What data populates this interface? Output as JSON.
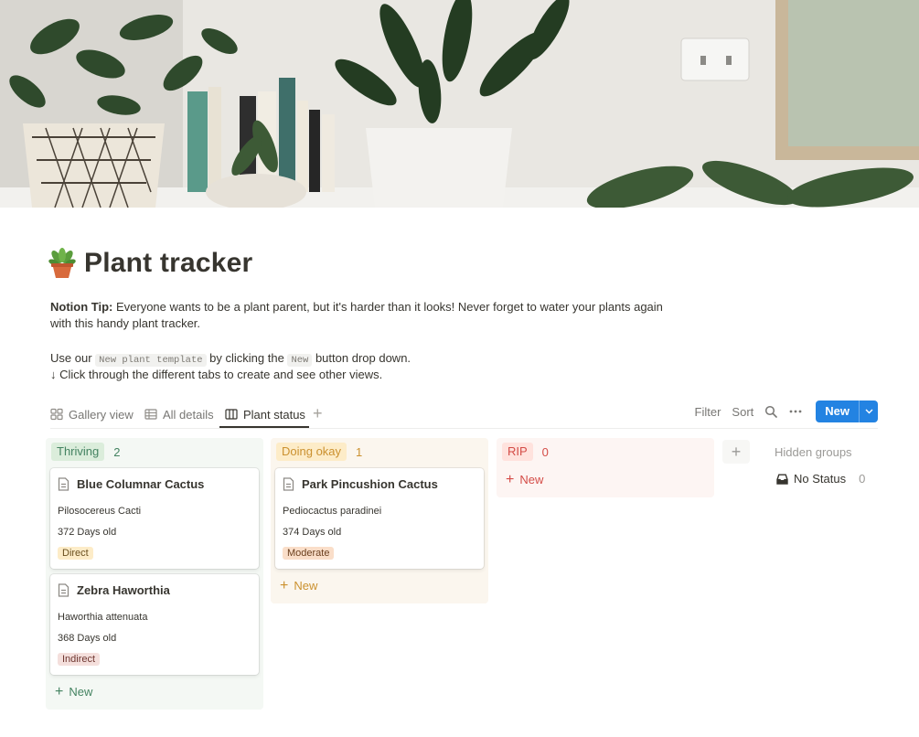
{
  "page": {
    "title": "Plant tracker",
    "tip_label": "Notion Tip:",
    "tip_text": " Everyone wants to be a plant parent, but it's harder than it looks! Never forget to water your plants again with this handy plant tracker.",
    "use_prefix": "Use our ",
    "template_code": "New plant template",
    "use_middle": " by clicking the ",
    "new_code": "New",
    "use_suffix": " button drop down.",
    "click_line": "↓ Click through the different tabs to create and see other views."
  },
  "views": {
    "tabs": [
      {
        "label": "Gallery view",
        "icon": "gallery-icon"
      },
      {
        "label": "All details",
        "icon": "table-icon"
      },
      {
        "label": "Plant status",
        "icon": "board-icon",
        "active": true
      }
    ],
    "filter": "Filter",
    "sort": "Sort",
    "new_button": "New"
  },
  "board": {
    "columns": [
      {
        "name": "Thriving",
        "count": "2",
        "color": "#448361",
        "pill_bg": "#dbeddb",
        "col_bg": "#f4f8f4",
        "cards": [
          {
            "title": "Blue Columnar Cactus",
            "species": "Pilosocereus Cacti",
            "age": "372 Days old",
            "light": "Direct",
            "tag_bg": "#fdecc8",
            "tag_color": "#6a4f1e"
          },
          {
            "title": "Zebra Haworthia",
            "species": "Haworthia attenuata",
            "age": "368 Days old",
            "light": "Indirect",
            "tag_bg": "#f4dfdc",
            "tag_color": "#6e3630"
          }
        ],
        "new_label": "New"
      },
      {
        "name": "Doing okay",
        "count": "1",
        "color": "#cb912f",
        "pill_bg": "#fdecc8",
        "col_bg": "#fbf6ee",
        "cards": [
          {
            "title": "Park Pincushion Cactus",
            "species": "Pediocactus paradinei",
            "age": "374 Days old",
            "light": "Moderate",
            "tag_bg": "#fadec9",
            "tag_color": "#6b3f1e"
          }
        ],
        "new_label": "New"
      },
      {
        "name": "RIP",
        "count": "0",
        "color": "#d44c47",
        "pill_bg": "#ffe2dd",
        "col_bg": "#fdf5f3",
        "cards": [],
        "new_label": "New"
      }
    ],
    "hidden_groups_label": "Hidden groups",
    "no_status_label": "No Status",
    "no_status_count": "0"
  }
}
